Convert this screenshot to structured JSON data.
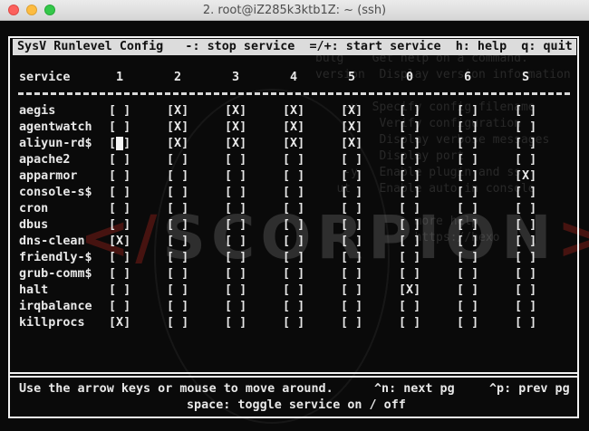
{
  "window": {
    "title": "2. root@iZ285k3ktb1Z: ~ (ssh)"
  },
  "header": {
    "text": "SysV Runlevel Config   -: stop service  =/+: start service  h: help  q: quit"
  },
  "columns": {
    "service_label": "service",
    "runlevels": [
      "1",
      "2",
      "3",
      "4",
      "5",
      "0",
      "6",
      "S"
    ]
  },
  "services": [
    {
      "name": "aegis",
      "states": [
        "[ ]",
        "[X]",
        "[X]",
        "[X]",
        "[X]",
        "[ ]",
        "[ ]",
        "[ ]"
      ]
    },
    {
      "name": "agentwatch",
      "states": [
        "[ ]",
        "[X]",
        "[X]",
        "[X]",
        "[X]",
        "[ ]",
        "[ ]",
        "[ ]"
      ]
    },
    {
      "name": "aliyun-rd$",
      "states": [
        "[ ]",
        "[X]",
        "[X]",
        "[X]",
        "[X]",
        "[ ]",
        "[ ]",
        "[ ]"
      ]
    },
    {
      "name": "apache2",
      "states": [
        "[ ]",
        "[ ]",
        "[ ]",
        "[ ]",
        "[ ]",
        "[ ]",
        "[ ]",
        "[ ]"
      ]
    },
    {
      "name": "apparmor",
      "states": [
        "[ ]",
        "[ ]",
        "[ ]",
        "[ ]",
        "[ ]",
        "[ ]",
        "[ ]",
        "[X]"
      ]
    },
    {
      "name": "console-s$",
      "states": [
        "[ ]",
        "[ ]",
        "[ ]",
        "[ ]",
        "[ ]",
        "[ ]",
        "[ ]",
        "[ ]"
      ]
    },
    {
      "name": "cron",
      "states": [
        "[ ]",
        "[ ]",
        "[ ]",
        "[ ]",
        "[ ]",
        "[ ]",
        "[ ]",
        "[ ]"
      ]
    },
    {
      "name": "dbus",
      "states": [
        "[ ]",
        "[ ]",
        "[ ]",
        "[ ]",
        "[ ]",
        "[ ]",
        "[ ]",
        "[ ]"
      ]
    },
    {
      "name": "dns-clean",
      "states": [
        "[X]",
        "[ ]",
        "[ ]",
        "[ ]",
        "[ ]",
        "[ ]",
        "[ ]",
        "[ ]"
      ]
    },
    {
      "name": "friendly-$",
      "states": [
        "[ ]",
        "[ ]",
        "[ ]",
        "[ ]",
        "[ ]",
        "[ ]",
        "[ ]",
        "[ ]"
      ]
    },
    {
      "name": "grub-comm$",
      "states": [
        "[ ]",
        "[ ]",
        "[ ]",
        "[ ]",
        "[ ]",
        "[ ]",
        "[ ]",
        "[ ]"
      ]
    },
    {
      "name": "halt",
      "states": [
        "[ ]",
        "[ ]",
        "[ ]",
        "[ ]",
        "[ ]",
        "[X]",
        "[ ]",
        "[ ]"
      ]
    },
    {
      "name": "irqbalance",
      "states": [
        "[ ]",
        "[ ]",
        "[ ]",
        "[ ]",
        "[ ]",
        "[ ]",
        "[ ]",
        "[ ]"
      ]
    },
    {
      "name": "killprocs",
      "states": [
        "[X]",
        "[ ]",
        "[ ]",
        "[ ]",
        "[ ]",
        "[ ]",
        "[ ]",
        "[ ]"
      ]
    }
  ],
  "cursor": {
    "row": 2,
    "col": 0
  },
  "footer": {
    "line1_left": "Use the arrow keys or mouse to move around.",
    "line1_mid": "^n: next pg",
    "line1_right": "^p: prev pg",
    "line2": "space: toggle service on / off"
  },
  "background": {
    "brand_left": "</",
    "brand_mid": "SCORPION",
    "brand_right": ">",
    "help_lines": "bulg    Get help on a command.\nversion  Display version information\n\n    -v  Specify config filename\n         Verify configuration\n         Display verbose messages\n         Display port\n    -y   Enable plugin and ss\n   ut    Enable auto in console\n\n              more help\n              https://hexo"
  },
  "colors": {
    "terminal_bg": "#0a0a0a",
    "text": "#e8e8e8",
    "header_bg": "#dcdcdc",
    "close": "#fc605c",
    "minimize": "#fdbc40",
    "maximize": "#34c84a"
  }
}
